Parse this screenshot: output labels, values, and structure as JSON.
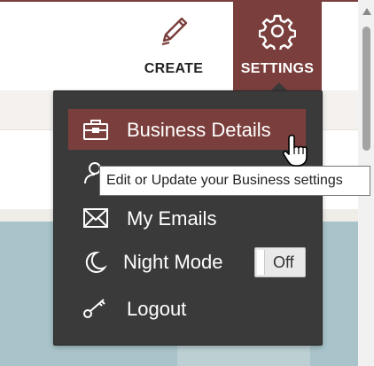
{
  "header": {
    "create_label": "CREATE",
    "settings_label": "SETTINGS",
    "create_icon": "pencil-icon",
    "settings_icon": "gear-icon"
  },
  "menu": {
    "items": [
      {
        "label": "Business Details",
        "icon": "briefcase-icon",
        "active": true
      },
      {
        "label": "",
        "icon": "user-icon",
        "active": false
      },
      {
        "label": "My Emails",
        "icon": "envelope-icon",
        "active": false
      },
      {
        "label": "Night Mode",
        "icon": "moon-icon",
        "active": false
      },
      {
        "label": "Logout",
        "icon": "key-icon",
        "active": false
      }
    ],
    "night_mode_toggle": "Off"
  },
  "tooltip": {
    "text": "Edit or Update your Business settings"
  },
  "colors": {
    "accent": "#7a3f3c",
    "menu_bg": "#3a3a3a",
    "menu_text": "#ffffff"
  }
}
